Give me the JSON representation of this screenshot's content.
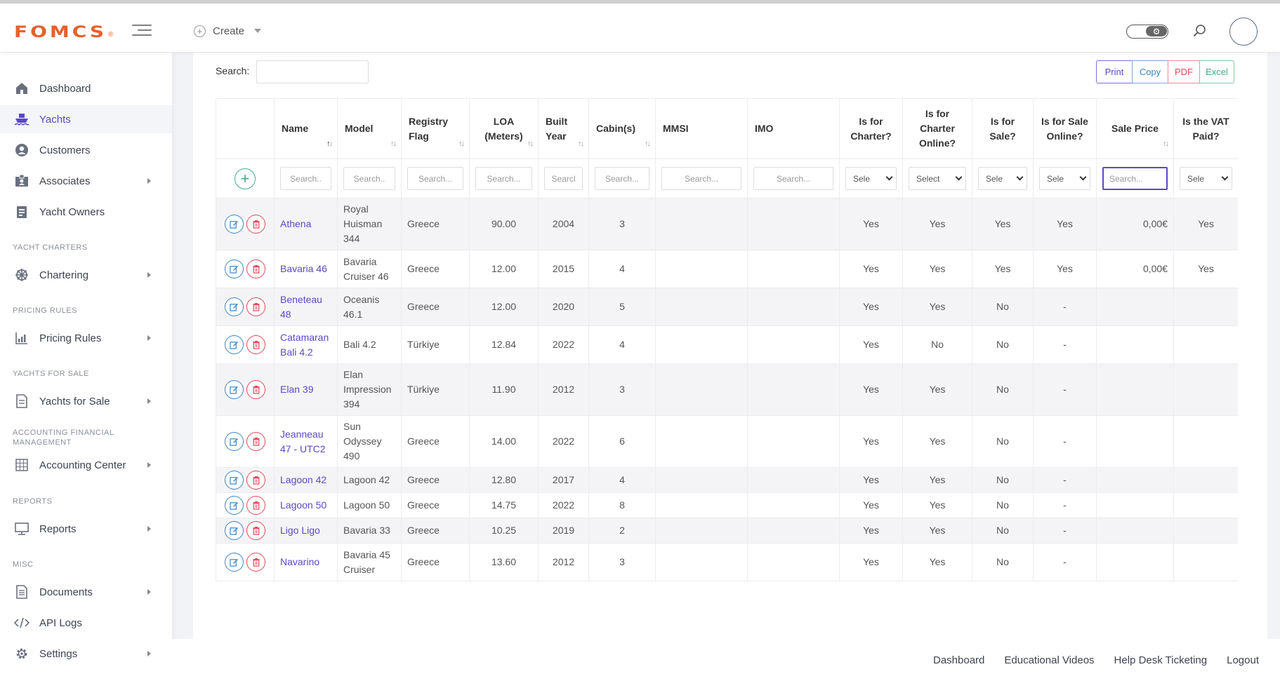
{
  "brand": {
    "name": "FOMCS",
    "reg": "®"
  },
  "navbar": {
    "create_label": "Create"
  },
  "sidebar": {
    "items": [
      {
        "label": "Dashboard",
        "icon": "home-icon"
      },
      {
        "label": "Yachts",
        "icon": "ship-icon"
      },
      {
        "label": "Customers",
        "icon": "user-circle-icon"
      },
      {
        "label": "Associates",
        "icon": "id-badge-icon"
      },
      {
        "label": "Yacht Owners",
        "icon": "clipboard-icon"
      },
      {
        "label": "Chartering",
        "icon": "helm-icon"
      },
      {
        "label": "Pricing Rules",
        "icon": "chart-icon"
      },
      {
        "label": "Yachts for Sale",
        "icon": "document-icon"
      },
      {
        "label": "Accounting Center",
        "icon": "grid-icon"
      },
      {
        "label": "Reports",
        "icon": "monitor-icon"
      },
      {
        "label": "Documents",
        "icon": "file-icon"
      },
      {
        "label": "API Logs",
        "icon": "code-icon"
      },
      {
        "label": "Settings",
        "icon": "gear-icon"
      }
    ],
    "headers": [
      "YACHT CHARTERS",
      "PRICING RULES",
      "YACHTS FOR SALE",
      "ACCOUNTING FINANCIAL MANAGEMENT",
      "REPORTS",
      "MISC"
    ]
  },
  "toolbar": {
    "search_label": "Search:",
    "print": "Print",
    "copy": "Copy",
    "pdf": "PDF",
    "excel": "Excel"
  },
  "table": {
    "headers": [
      "Name",
      "Model",
      "Registry Flag",
      "LOA (Meters)",
      "Built Year",
      "Cabin(s)",
      "MMSI",
      "IMO",
      "Is for Charter?",
      "Is for Charter Online?",
      "Is for Sale?",
      "Is for Sale Online?",
      "Sale Price",
      "Is the VAT Paid?"
    ],
    "filters": [
      "Search..",
      "Search..",
      "Search...",
      "Search...",
      "Searcl",
      "Search...",
      "Search...",
      "Search...",
      "Sele",
      "Select",
      "Sele",
      "Sele",
      "Search...",
      "Sele"
    ],
    "rows": [
      [
        "Athena",
        "Royal Huisman 344",
        "Greece",
        "90.00",
        "2004",
        "3",
        "",
        "",
        "Yes",
        "Yes",
        "Yes",
        "Yes",
        "0,00€",
        "Yes"
      ],
      [
        "Bavaria 46",
        "Bavaria Cruiser 46",
        "Greece",
        "12.00",
        "2015",
        "4",
        "",
        "",
        "Yes",
        "Yes",
        "Yes",
        "Yes",
        "0,00€",
        "Yes"
      ],
      [
        "Beneteau 48",
        "Oceanis 46.1",
        "Greece",
        "12.00",
        "2020",
        "5",
        "",
        "",
        "Yes",
        "Yes",
        "No",
        "-",
        "",
        ""
      ],
      [
        "Catamaran Bali 4.2",
        "Bali 4.2",
        "Türkiye",
        "12.84",
        "2022",
        "4",
        "",
        "",
        "Yes",
        "No",
        "No",
        "-",
        "",
        ""
      ],
      [
        "Elan 39",
        "Elan Impression 394",
        "Türkiye",
        "11.90",
        "2012",
        "3",
        "",
        "",
        "Yes",
        "Yes",
        "No",
        "-",
        "",
        ""
      ],
      [
        "Jeanneau 47 - UTC2",
        "Sun Odyssey 490",
        "Greece",
        "14.00",
        "2022",
        "6",
        "",
        "",
        "Yes",
        "Yes",
        "No",
        "-",
        "",
        ""
      ],
      [
        "Lagoon 42",
        "Lagoon 42",
        "Greece",
        "12.80",
        "2017",
        "4",
        "",
        "",
        "Yes",
        "Yes",
        "No",
        "-",
        "",
        ""
      ],
      [
        "Lagoon 50",
        "Lagoon 50",
        "Greece",
        "14.75",
        "2022",
        "8",
        "",
        "",
        "Yes",
        "Yes",
        "No",
        "-",
        "",
        ""
      ],
      [
        "Ligo Ligo",
        "Bavaria 33",
        "Greece",
        "10.25",
        "2019",
        "2",
        "",
        "",
        "Yes",
        "Yes",
        "No",
        "-",
        "",
        ""
      ],
      [
        "Navarino",
        "Bavaria 45 Cruiser",
        "Greece",
        "13.60",
        "2012",
        "3",
        "",
        "",
        "Yes",
        "Yes",
        "No",
        "-",
        "",
        ""
      ]
    ]
  },
  "footer": {
    "links": [
      "Dashboard",
      "Educational Videos",
      "Help Desk Ticketing",
      "Logout"
    ]
  },
  "colors": {
    "accent": "#5b48c8",
    "brand": "#e7602a",
    "edit": "#3b86c9",
    "delete": "#e5475b",
    "add": "#3fae83"
  }
}
